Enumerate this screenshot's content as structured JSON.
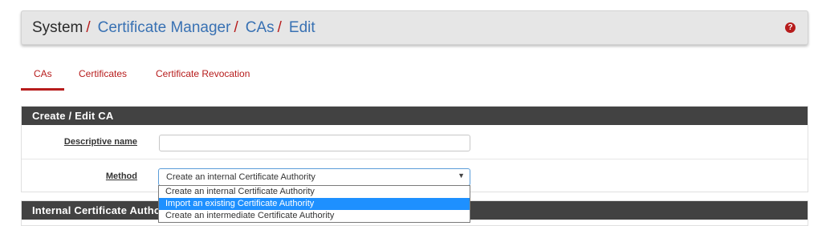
{
  "breadcrumb": {
    "root": "System",
    "separator": "/",
    "items": [
      "Certificate Manager",
      "CAs",
      "Edit"
    ]
  },
  "help_icon": "help-circle-icon",
  "tabs": [
    {
      "label": "CAs",
      "active": true
    },
    {
      "label": "Certificates",
      "active": false
    },
    {
      "label": "Certificate Revocation",
      "active": false
    }
  ],
  "panel": {
    "title": "Create / Edit CA",
    "descriptive_name": {
      "label": "Descriptive name",
      "value": ""
    },
    "method": {
      "label": "Method",
      "value": "Create an internal Certificate Authority",
      "options": [
        "Create an internal Certificate Authority",
        "Import an existing Certificate Authority",
        "Create an intermediate Certificate Authority"
      ],
      "highlighted_index": 1
    }
  },
  "panel2": {
    "title": "Internal Certificate Authority"
  },
  "colors": {
    "accent_red": "#b71c1c",
    "link_blue": "#3871b3",
    "heading_dark": "#424242",
    "dropdown_highlight": "#1e90ff"
  }
}
